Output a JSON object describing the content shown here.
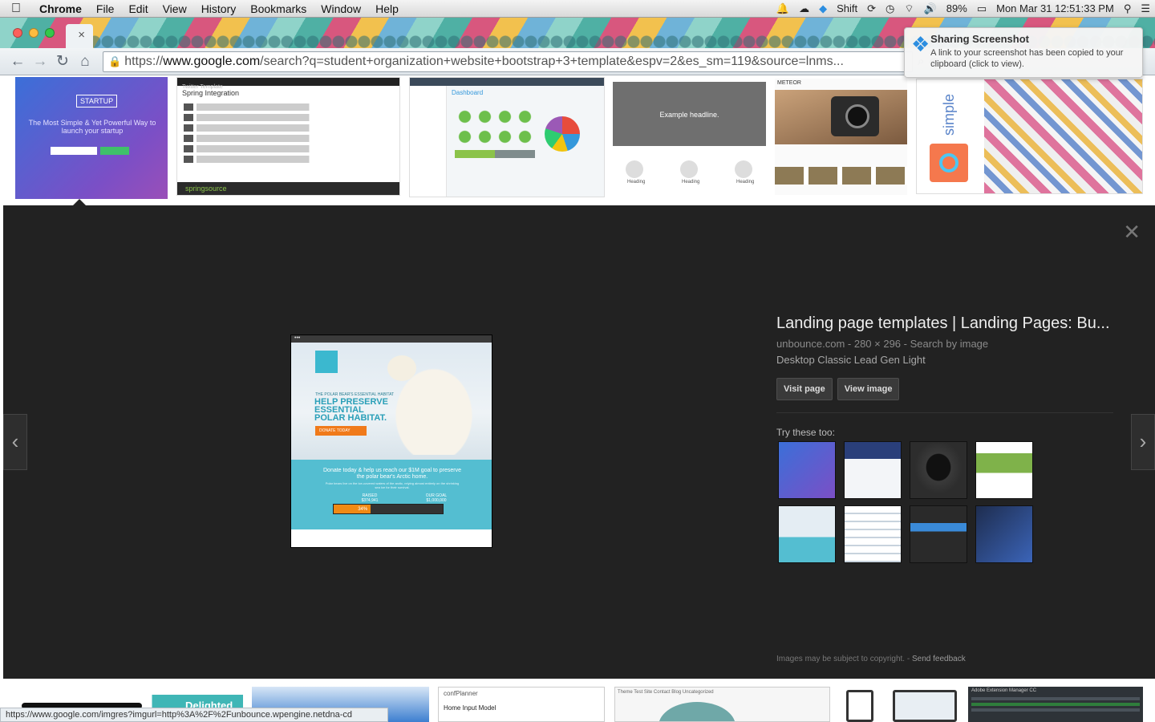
{
  "menubar": {
    "app": "Chrome",
    "items": [
      "File",
      "Edit",
      "View",
      "History",
      "Bookmarks",
      "Window",
      "Help"
    ],
    "status": {
      "shift": "Shift",
      "battery": "89%",
      "datetime": "Mon Mar 31  12:51:33 PM"
    },
    "icons": [
      "apple-icon",
      "notification-bell-icon",
      "cloud-icon",
      "dropbox-icon",
      "sync-icon",
      "time-machine-icon",
      "wifi-icon",
      "volume-icon",
      "battery-icon",
      "spotlight-icon",
      "menu-list-icon"
    ]
  },
  "browser": {
    "tab": {
      "close_label": "×"
    },
    "toolbar": {
      "back": "←",
      "forward": "→",
      "reload": "↻",
      "home": "⌂"
    },
    "omnibox": {
      "scheme": "https://",
      "host": "www.google.com",
      "path": "/search?q=student+organization+website+bootstrap+3+template&espv=2&es_sm=119&source=lnms..."
    }
  },
  "notification": {
    "title": "Sharing Screenshot",
    "body": "A link to your screenshot has been copied to your clipboard (click to view)."
  },
  "thumbnails_top": [
    {
      "badge": "STARTUP",
      "text": "The Most Simple & Yet Powerful Way to launch your startup"
    },
    {
      "header": "Twitter Template",
      "title": "Spring Integration",
      "footer": "springsource"
    },
    {
      "title": "Dashboard"
    },
    {
      "headline": "Example headline.",
      "labels": [
        "Heading",
        "Heading",
        "Heading"
      ]
    },
    {
      "brand": "METEOR"
    },
    {
      "brand": "simple"
    }
  ],
  "preview": {
    "kicker": "THE POLAR BEAR'S ESSENTIAL HABITAT",
    "headline": "HELP PRESERVE ESSENTIAL POLAR HABITAT.",
    "donate_label": "DONATE TODAY",
    "sea_text": "Donate today & help us reach our $1M goal to preserve the polar bear's Arctic home.",
    "sea_small": "Polar bears live on the ice-covered waters of the arctic, relying almost entirely on the shrinking sea ice for their survival.",
    "raised_label": "RAISED",
    "raised_value": "$374,941",
    "goal_label": "OUR GOAL",
    "goal_value": "$1,000,000",
    "progress_label": "34%",
    "progress_fraction": 0.34
  },
  "info": {
    "title": "Landing page templates | Landing Pages: Bu...",
    "meta": "unbounce.com - 280 × 296 - Search by image",
    "description": "Desktop Classic Lead Gen Light",
    "visit_label": "Visit page",
    "view_label": "View image",
    "try_label": "Try these too:"
  },
  "legal": {
    "text": "Images may be subject to copyright. - ",
    "feedback": "Send feedback"
  },
  "bottom_strip": {
    "delighted": "Delighted",
    "planner_title": "confPlanner",
    "planner_sub": "Home Input Model",
    "theme_nav": "Theme Test Site   Contact   Blog   Uncategorized",
    "adobe_title": "Adobe Extension Manager CC"
  },
  "statusbar": {
    "url": "https://www.google.com/imgres?imgurl=http%3A%2F%2Funbounce.wpengine.netdna-cd"
  },
  "colors": {
    "panel_bg": "#222222",
    "accent_orange": "#f08a14",
    "sea_blue": "#54bed1",
    "link_gray": "#999999"
  }
}
